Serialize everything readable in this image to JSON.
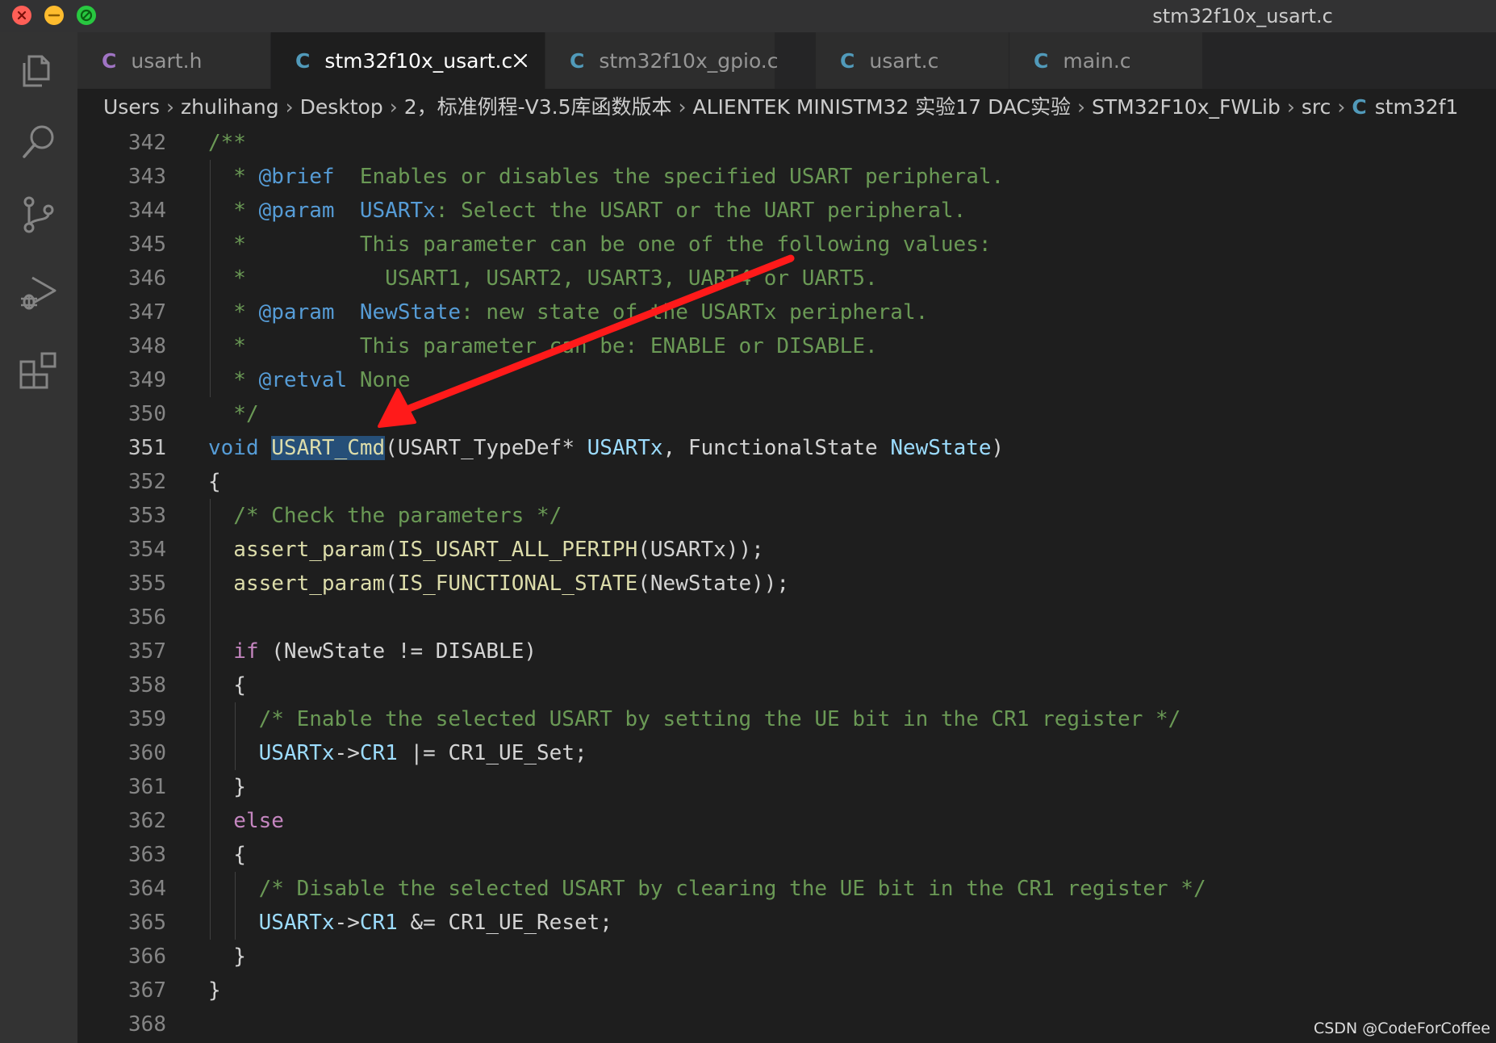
{
  "window": {
    "title": "stm32f10x_usart.c"
  },
  "activity_bar": {
    "items": [
      "explorer-icon",
      "search-icon",
      "source-control-icon",
      "run-debug-icon",
      "extensions-icon"
    ]
  },
  "tabs": [
    {
      "icon": "C",
      "label": "usart.h",
      "active": false
    },
    {
      "icon": "C",
      "label": "stm32f10x_usart.c",
      "active": true
    },
    {
      "icon": "C",
      "label": "stm32f10x_gpio.c",
      "active": false
    },
    {
      "icon": "C",
      "label": "usart.c",
      "active": false
    },
    {
      "icon": "C",
      "label": "main.c",
      "active": false
    }
  ],
  "breadcrumbs": {
    "items": [
      "Users",
      "zhulihang",
      "Desktop",
      "2，标准例程-V3.5库函数版本",
      "ALIENTEK MINISTM32 实验17 DAC实验",
      "STM32F10x_FWLib",
      "src"
    ],
    "file_icon": "C",
    "file": "stm32f1"
  },
  "editor": {
    "active_line": "351",
    "line_numbers": [
      "342",
      "343",
      "344",
      "345",
      "346",
      "347",
      "348",
      "349",
      "350",
      "351",
      "352",
      "353",
      "354",
      "355",
      "356",
      "357",
      "358",
      "359",
      "360",
      "361",
      "362",
      "363",
      "364",
      "365",
      "366",
      "367",
      "368"
    ],
    "code": {
      "l342": "/**",
      "l343_star": "  * ",
      "l343_tag": "@brief",
      "l343_text": "  Enables or disables the specified USART peripheral.",
      "l344_star": "  * ",
      "l344_tag": "@param",
      "l344_param": "  USARTx",
      "l344_text": ": Select the USART or the UART peripheral.",
      "l345": "  *         This parameter can be one of the following values:",
      "l346": "  *           USART1, USART2, USART3, UART4 or UART5.",
      "l347_star": "  * ",
      "l347_tag": "@param",
      "l347_param": "  NewState",
      "l347_text": ": new state of the USARTx peripheral.",
      "l348": "  *         This parameter can be: ENABLE or DISABLE.",
      "l349_star": "  * ",
      "l349_tag": "@retval",
      "l349_text": " None",
      "l350": "  */",
      "l351_void": "void",
      "l351_fn": "USART_Cmd",
      "l351_open": "(USART_TypeDef* ",
      "l351_p1": "USARTx",
      "l351_mid": ", FunctionalState ",
      "l351_p2": "NewState",
      "l351_close": ")",
      "l352": "{",
      "l353": "  /* Check the parameters */",
      "l354_fn": "  assert_param",
      "l354_open": "(",
      "l354_mac": "IS_USART_ALL_PERIPH",
      "l354_rest": "(USARTx));",
      "l355_fn": "  assert_param",
      "l355_open": "(",
      "l355_mac": "IS_FUNCTIONAL_STATE",
      "l355_rest": "(NewState));",
      "l356": "",
      "l357_kw": "  if",
      "l357_rest": " (NewState != DISABLE)",
      "l358": "  {",
      "l359": "    /* Enable the selected USART by setting the UE bit in the CR1 register */",
      "l360_a": "    USARTx",
      "l360_b": "->",
      "l360_c": "CR1",
      "l360_d": " |= CR1_UE_Set;",
      "l361": "  }",
      "l362": "  else",
      "l363": "  {",
      "l364": "    /* Disable the selected USART by clearing the UE bit in the CR1 register */",
      "l365_a": "    USARTx",
      "l365_b": "->",
      "l365_c": "CR1",
      "l365_d": " &= CR1_UE_Reset;",
      "l366": "  }",
      "l367": "}",
      "l368": ""
    }
  },
  "annotation": {
    "arrow_color": "#ff1a1a"
  },
  "watermark": "CSDN @CodeForCoffee",
  "colors": {
    "comment": "#6a9955",
    "doc_tag": "#569cd6",
    "parameter": "#9cdcfe",
    "keyword": "#569cd6",
    "control": "#c586c0",
    "function": "#dcdcaa",
    "selection": "#264f78"
  }
}
